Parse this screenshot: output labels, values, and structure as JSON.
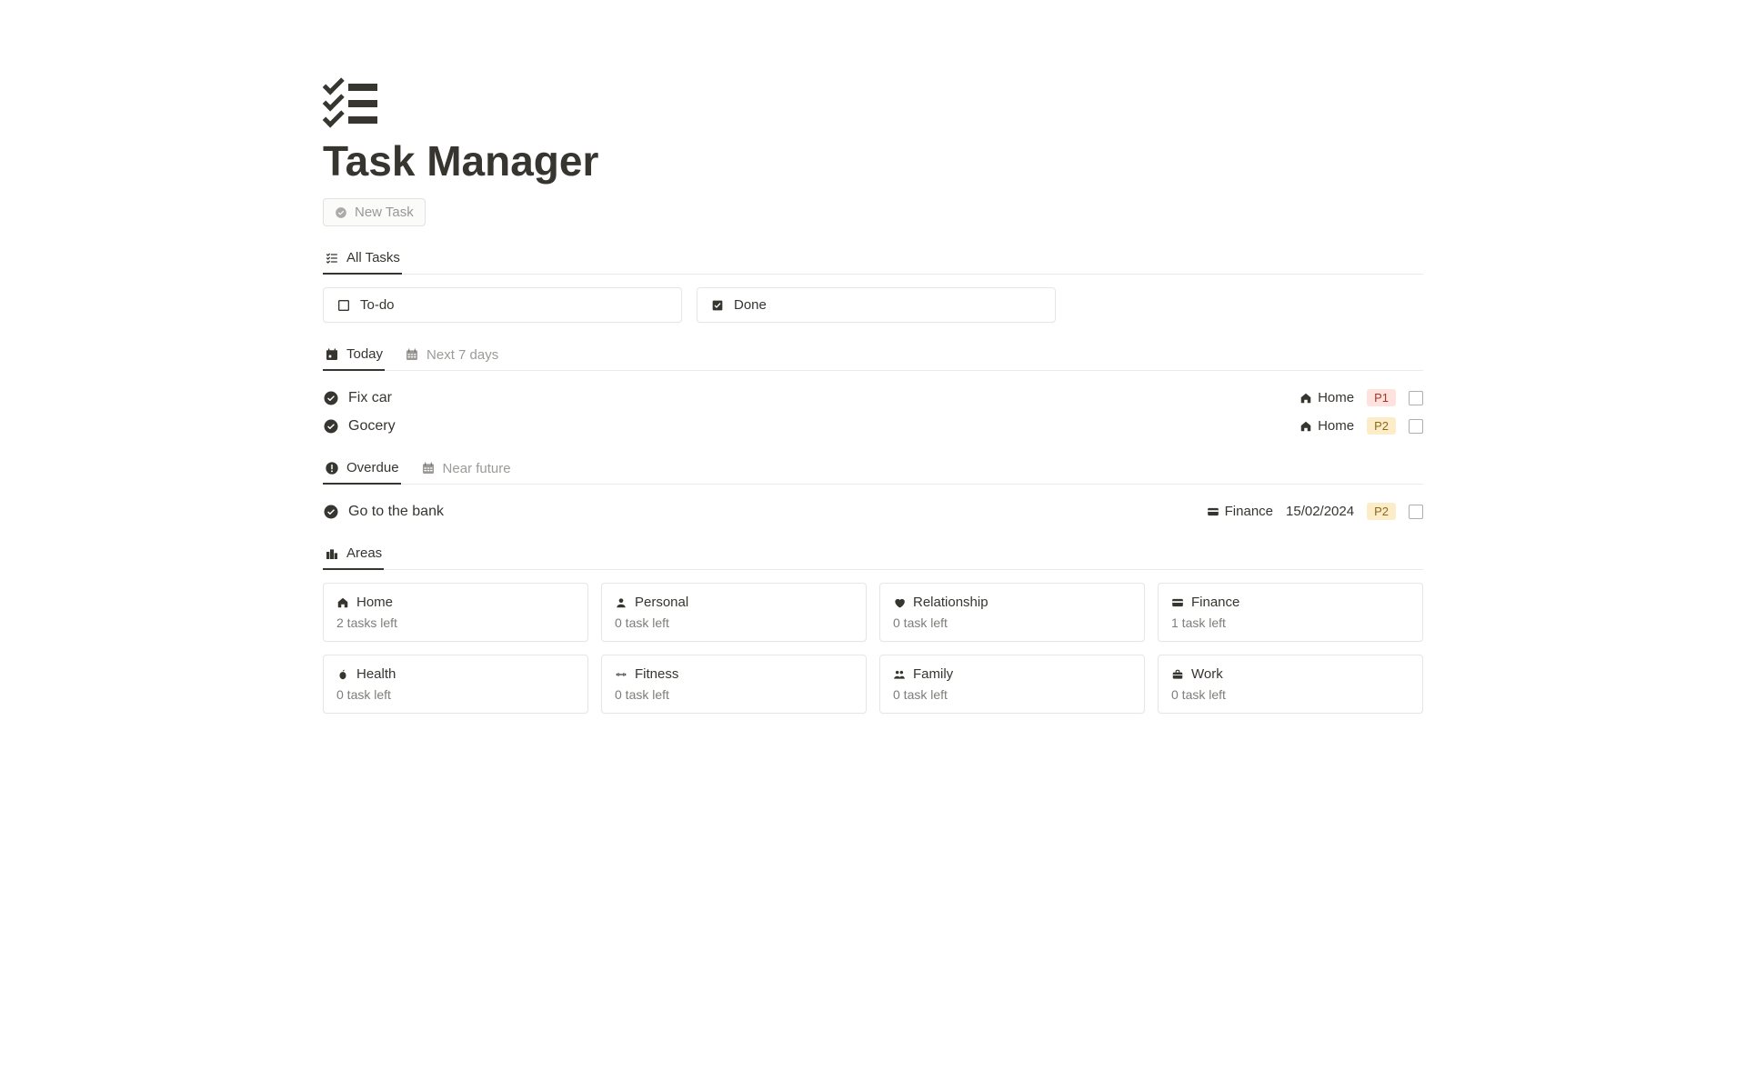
{
  "page": {
    "title": "Task Manager",
    "new_task_label": "New Task"
  },
  "main_view": {
    "tab": "All Tasks"
  },
  "filters": {
    "todo": "To-do",
    "done": "Done"
  },
  "time_tabs": {
    "today": "Today",
    "next7": "Next 7 days"
  },
  "today_tasks": [
    {
      "title": "Fix car",
      "area": "Home",
      "priority": "P1"
    },
    {
      "title": "Gocery",
      "area": "Home",
      "priority": "P2"
    }
  ],
  "overdue_tabs": {
    "overdue": "Overdue",
    "near": "Near future"
  },
  "overdue_tasks": [
    {
      "title": "Go to the bank",
      "area": "Finance",
      "date": "15/02/2024",
      "priority": "P2"
    }
  ],
  "areas_tab": "Areas",
  "areas": [
    {
      "name": "Home",
      "sub": "2 tasks left",
      "icon": "home"
    },
    {
      "name": "Personal",
      "sub": "0 task left",
      "icon": "person"
    },
    {
      "name": "Relationship",
      "sub": "0 task left",
      "icon": "heart"
    },
    {
      "name": "Finance",
      "sub": "1 task left",
      "icon": "card"
    },
    {
      "name": "Health",
      "sub": "0 task left",
      "icon": "apple"
    },
    {
      "name": "Fitness",
      "sub": "0 task left",
      "icon": "dumbbell"
    },
    {
      "name": "Family",
      "sub": "0 task left",
      "icon": "family"
    },
    {
      "name": "Work",
      "sub": "0 task left",
      "icon": "briefcase"
    }
  ],
  "colors": {
    "P1": "#ffe2dd",
    "P2": "#fdecc8"
  }
}
